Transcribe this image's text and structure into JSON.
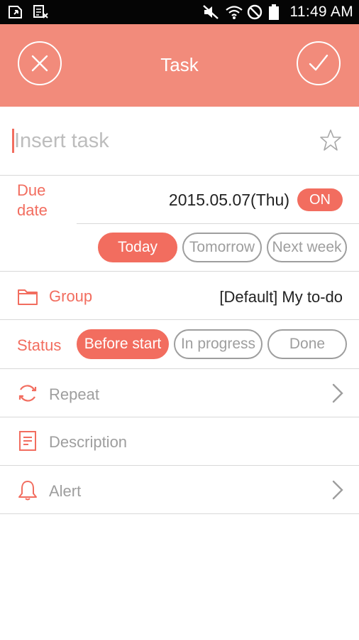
{
  "status_bar": {
    "time": "11:49 AM",
    "icons": [
      "notification-icon",
      "notification-icon-2",
      "mute-icon",
      "wifi-icon",
      "do-not-disturb-icon",
      "battery-icon"
    ]
  },
  "header": {
    "title": "Task",
    "close_icon": "close-icon",
    "confirm_icon": "checkmark-icon",
    "color": "#f28b7b"
  },
  "task": {
    "placeholder": "Insert task",
    "value": "",
    "star_icon": "star-icon"
  },
  "due_date": {
    "label": "Due date",
    "date": "2015.05.07(Thu)",
    "toggle": "ON",
    "quick_options": [
      {
        "label": "Today",
        "selected": true
      },
      {
        "label": "Tomorrow",
        "selected": false
      },
      {
        "label": "Next week",
        "selected": false
      }
    ]
  },
  "group": {
    "label": "Group",
    "icon": "folder-icon",
    "value": "[Default] My to-do"
  },
  "status": {
    "label": "Status",
    "options": [
      {
        "label": "Before start",
        "selected": true
      },
      {
        "label": "In progress",
        "selected": false
      },
      {
        "label": "Done",
        "selected": false
      }
    ]
  },
  "rows": {
    "repeat": {
      "label": "Repeat",
      "icon": "repeat-icon"
    },
    "description": {
      "label": "Description",
      "icon": "document-icon"
    },
    "alert": {
      "label": "Alert",
      "icon": "bell-icon"
    }
  },
  "colors": {
    "accent": "#f26d5f",
    "header": "#f28b7b",
    "muted": "#9e9e9e"
  }
}
